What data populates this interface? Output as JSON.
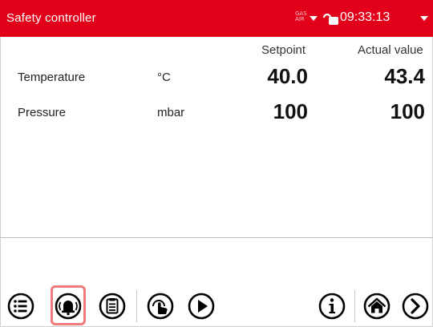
{
  "header": {
    "title": "Safety controller",
    "gas_line1": "GAS",
    "gas_line2": "AIR",
    "time": "09:33:13"
  },
  "columns": {
    "setpoint": "Setpoint",
    "actual": "Actual value"
  },
  "rows": [
    {
      "label": "Temperature",
      "unit": "°C",
      "setpoint": "40.0",
      "actual": "43.4"
    },
    {
      "label": "Pressure",
      "unit": "mbar",
      "setpoint": "100",
      "actual": "100"
    }
  ],
  "toolbar": {
    "items": [
      "menu-icon",
      "alarm-bell-icon",
      "clipboard-icon",
      "hand-touch-icon",
      "play-icon",
      "info-icon",
      "home-icon",
      "forward-icon"
    ],
    "highlighted": "alarm-bell-icon"
  },
  "colors": {
    "titlebar": "#e3001b",
    "highlight": "#ef7a7a"
  }
}
